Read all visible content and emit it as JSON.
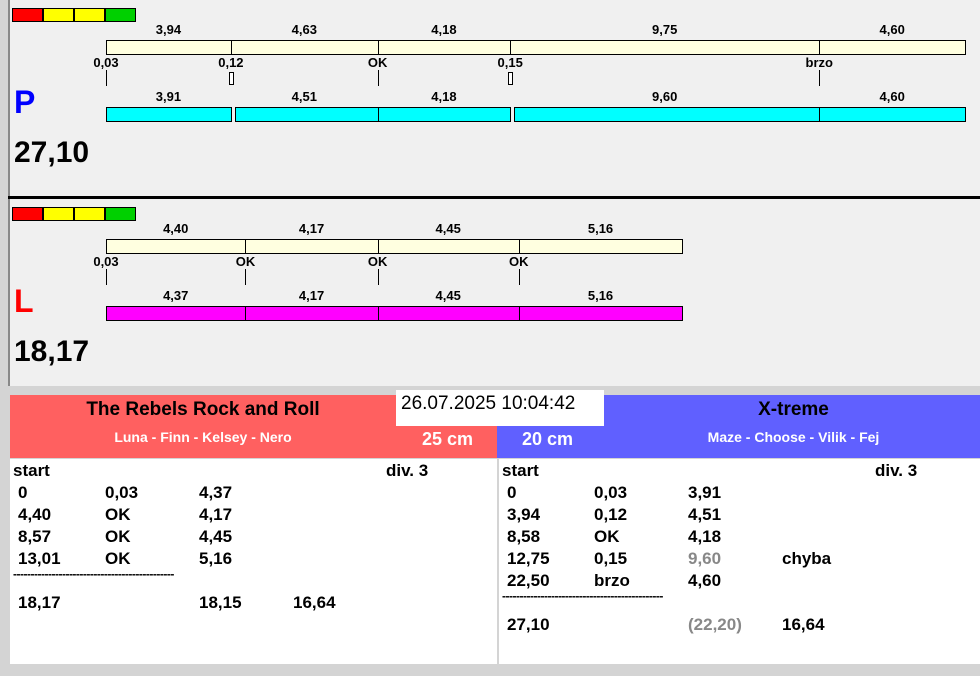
{
  "colors": {
    "quality": [
      "#ff0000",
      "#ffff00",
      "#ffff00",
      "#00d000"
    ],
    "p_bar": "#00ffff",
    "l_bar": "#ff00ff",
    "ref_bar": "#ffffe0",
    "left_team": "#ff6060",
    "right_team": "#6060ff"
  },
  "top": {
    "letter": "P",
    "total": "27,10",
    "ref": [
      "3,94",
      "4,63",
      "4,18",
      "9,75",
      "4,60"
    ],
    "ref_values": [
      3.94,
      4.63,
      4.18,
      9.75,
      4.6
    ],
    "marks": [
      "0,03",
      "0,12",
      "OK",
      "0,15",
      "brzo"
    ],
    "mark_fault": [
      false,
      true,
      false,
      true,
      false
    ],
    "run": [
      "3,91",
      "4,51",
      "4,18",
      "9,60",
      "4,60"
    ]
  },
  "bottom": {
    "letter": "L",
    "total": "18,17",
    "ref": [
      "4,40",
      "4,17",
      "4,45",
      "5,16"
    ],
    "ref_values": [
      4.4,
      4.17,
      4.45,
      5.16
    ],
    "marks": [
      "0,03",
      "OK",
      "OK",
      "OK"
    ],
    "mark_fault": [
      false,
      false,
      false,
      false
    ],
    "run": [
      "4,37",
      "4,17",
      "4,45",
      "5,16"
    ]
  },
  "datetime": "26.07.2025 10:04:42",
  "left_team": {
    "name": "The Rebels Rock and Roll",
    "members": "Luna - Finn - Kelsey - Nero",
    "height": "25 cm",
    "start": "start",
    "division": "div.  3",
    "rows": [
      [
        "0",
        "0,03",
        "4,37",
        ""
      ],
      [
        "4,40",
        "OK",
        "4,17",
        ""
      ],
      [
        "8,57",
        "OK",
        "4,45",
        ""
      ],
      [
        "13,01",
        "OK",
        "5,16",
        ""
      ]
    ],
    "separator": "----------------------------------------------",
    "totals": [
      "18,17",
      "",
      "18,15",
      "16,64"
    ]
  },
  "right_team": {
    "name": "X-treme",
    "members": "Maze - Choose - Vilik - Fej",
    "height": "20 cm",
    "start": "start",
    "division": "div.  3",
    "rows": [
      [
        "0",
        "0,03",
        "3,91",
        ""
      ],
      [
        "3,94",
        "0,12",
        "4,51",
        ""
      ],
      [
        "8,58",
        "OK",
        "4,18",
        ""
      ],
      [
        "12,75",
        "0,15",
        "9,60",
        "chyba"
      ],
      [
        "22,50",
        "brzo",
        "4,60",
        ""
      ]
    ],
    "separator": "----------------------------------------------",
    "totals": [
      "27,10",
      "",
      "(22,20)",
      "16,64"
    ]
  }
}
